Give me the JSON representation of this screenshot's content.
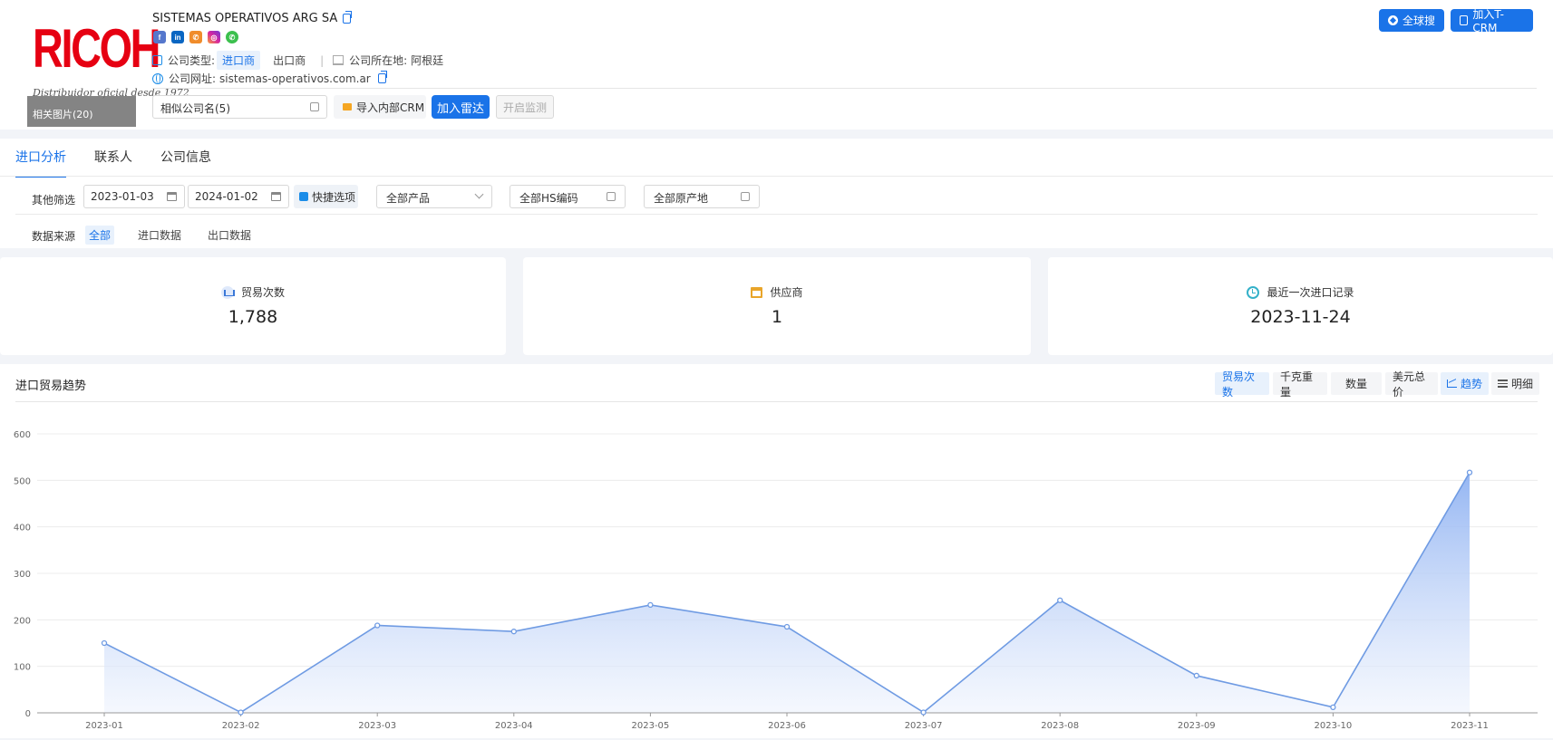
{
  "header": {
    "logo_text": "RICOH",
    "logo_tagline": "Distribuidor oficial desde 1972",
    "related_images": "相关图片(20)",
    "company_name": "SISTEMAS OPERATIVOS ARG SA",
    "type_label": "公司类型:",
    "type_importer": "进口商",
    "type_exporter": "出口商",
    "location_label": "公司所在地:",
    "location_value": "阿根廷",
    "website_label": "公司网址:",
    "website_value": "sistemas-operativos.com.ar",
    "similar_companies": "相似公司名(5)",
    "import_crm": "导入内部CRM",
    "add_radar": "加入雷达",
    "start_monitor": "开启监测",
    "global_search": "全球搜",
    "add_tcrm": "加入T-CRM",
    "socials": [
      "f",
      "in",
      "✆",
      "◎",
      "✆"
    ]
  },
  "tabs": [
    "进口分析",
    "联系人",
    "公司信息"
  ],
  "filters": {
    "label": "其他筛选",
    "date_start": "2023-01-03",
    "date_end": "2024-01-02",
    "quick_options": "快捷选项",
    "product": "全部产品",
    "hs_code": "全部HS编码",
    "origin": "全部原产地",
    "source_label": "数据来源",
    "source_all": "全部",
    "source_import": "进口数据",
    "source_export": "出口数据"
  },
  "stats": [
    {
      "label": "贸易次数",
      "value": "1,788"
    },
    {
      "label": "供应商",
      "value": "1"
    },
    {
      "label": "最近一次进口记录",
      "value": "2023-11-24"
    }
  ],
  "chart_section": {
    "title": "进口贸易趋势",
    "metrics": [
      "贸易次数",
      "千克重量",
      "数量",
      "美元总价"
    ],
    "views": [
      "趋势",
      "明细"
    ]
  },
  "chart_data": {
    "type": "area",
    "categories": [
      "2023-01",
      "2023-02",
      "2023-03",
      "2023-04",
      "2023-05",
      "2023-06",
      "2023-07",
      "2023-08",
      "2023-09",
      "2023-10",
      "2023-11"
    ],
    "values": [
      150,
      1,
      188,
      175,
      232,
      185,
      1,
      242,
      80,
      12,
      517
    ],
    "ylim": [
      0,
      600
    ],
    "yticks": [
      0,
      100,
      200,
      300,
      400,
      500,
      600
    ],
    "grid": true,
    "colors": {
      "line": "#6f9be3",
      "fill_top": "#8fb2f2",
      "fill_bottom": "#eef3fd"
    }
  }
}
